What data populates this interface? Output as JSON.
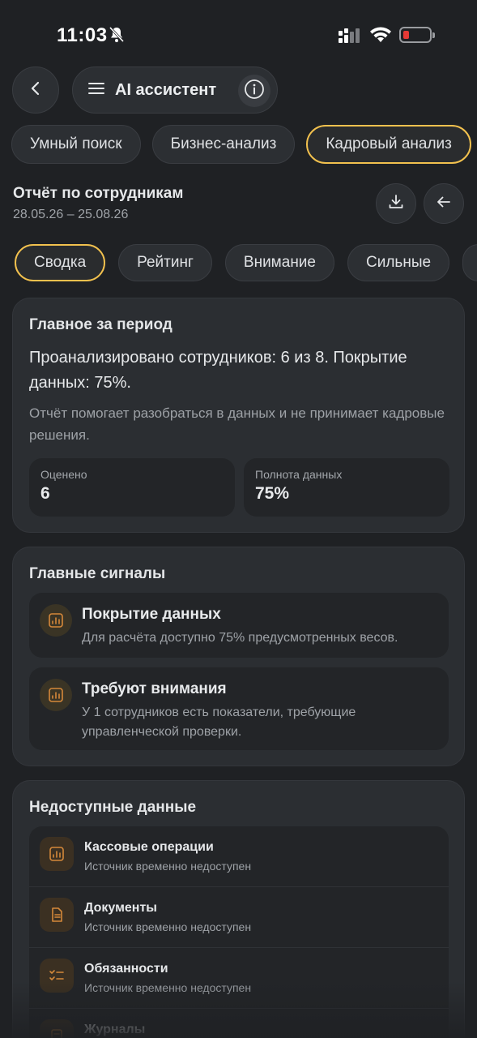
{
  "status_bar": {
    "time": "11:03"
  },
  "header": {
    "title": "AI ассистент"
  },
  "mode_tabs": [
    {
      "label": "Умный поиск",
      "active": false
    },
    {
      "label": "Бизнес-анализ",
      "active": false
    },
    {
      "label": "Кадровый анализ",
      "active": true
    }
  ],
  "report": {
    "title": "Отчёт по сотрудникам",
    "dates": "28.05.26 – 25.08.26"
  },
  "section_tabs": [
    {
      "label": "Сводка",
      "active": true
    },
    {
      "label": "Рейтинг",
      "active": false
    },
    {
      "label": "Внимание",
      "active": false
    },
    {
      "label": "Сильные",
      "active": false
    }
  ],
  "summary": {
    "title": "Главное за период",
    "main": "Проанализировано сотрудников: 6 из 8. Покрытие данных: 75%.",
    "note": "Отчёт помогает разобраться в данных и не принимает кадровые решения.",
    "stats": [
      {
        "label": "Оценено",
        "value": "6"
      },
      {
        "label": "Полнота данных",
        "value": "75%"
      }
    ]
  },
  "signals": {
    "title": "Главные сигналы",
    "items": [
      {
        "title": "Покрытие данных",
        "desc": "Для расчёта доступно 75% предусмотренных весов.",
        "icon": "chart-icon"
      },
      {
        "title": "Требуют внимания",
        "desc": "У 1 сотрудников есть показатели, требующие управленческой проверки.",
        "icon": "chart-icon"
      }
    ]
  },
  "unavailable": {
    "title": "Недоступные данные",
    "items": [
      {
        "title": "Кассовые операции",
        "sub": "Источник временно недоступен",
        "icon": "chart-icon"
      },
      {
        "title": "Документы",
        "sub": "Источник временно недоступен",
        "icon": "document-icon"
      },
      {
        "title": "Обязанности",
        "sub": "Источник временно недоступен",
        "icon": "checklist-icon"
      },
      {
        "title": "Журналы",
        "sub": "",
        "icon": "journal-icon"
      }
    ]
  },
  "colors": {
    "accent": "#f2c14e",
    "background": "#1f2124",
    "card": "#2b2e32",
    "icon_orange": "#d4883a"
  }
}
